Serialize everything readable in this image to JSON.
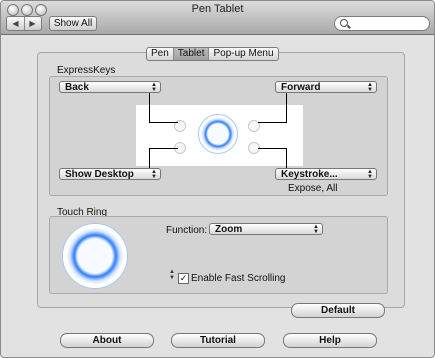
{
  "window": {
    "title": "Pen Tablet"
  },
  "toolbar": {
    "back": "◀",
    "forward": "▶",
    "show_all": "Show All",
    "search_placeholder": ""
  },
  "tabs": [
    "Pen",
    "Tablet",
    "Pop-up Menu"
  ],
  "expresskeys": {
    "label": "ExpressKeys",
    "top_left": "Back",
    "top_right": "Forward",
    "bottom_left": "Show Desktop",
    "bottom_right": "Keystroke...",
    "bottom_right_caption": "Expose, All"
  },
  "touch_ring": {
    "label": "Touch Ring",
    "function_label": "Function:",
    "function_value": "Zoom",
    "fast_scrolling_label": "Enable Fast Scrolling",
    "fast_scrolling_checked": "✓"
  },
  "buttons": {
    "default": "Default",
    "about": "About",
    "tutorial": "Tutorial",
    "help": "Help"
  },
  "colors": {
    "ring_blue": "#2f7dff",
    "window_bg": "#e2e2e2"
  }
}
